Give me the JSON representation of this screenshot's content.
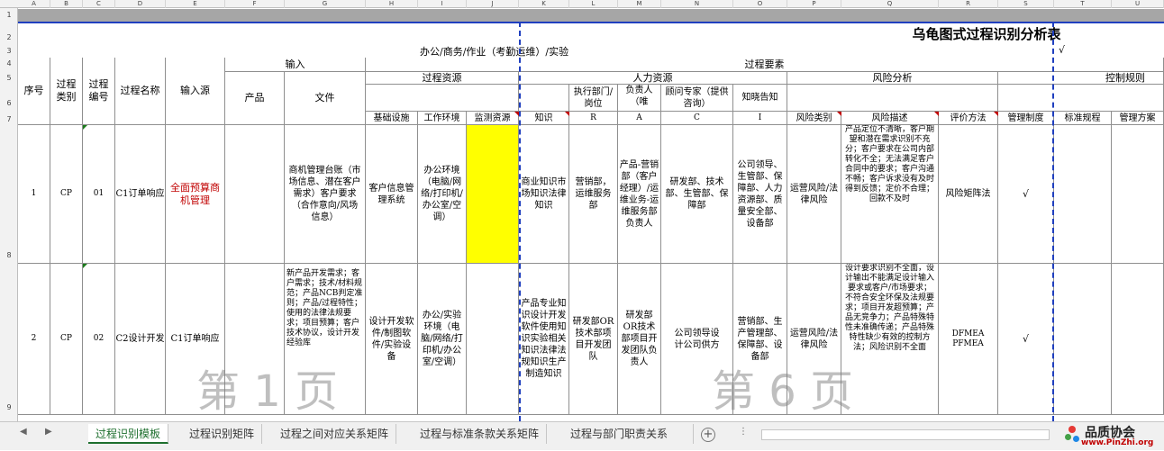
{
  "columns": [
    "A",
    "B",
    "C",
    "D",
    "E",
    "F",
    "G",
    "H",
    "I",
    "J",
    "K",
    "L",
    "M",
    "N",
    "O",
    "P",
    "Q",
    "R",
    "S",
    "T",
    "U"
  ],
  "rows": [
    "1",
    "2",
    "3",
    "4",
    "5",
    "6",
    "7",
    "8",
    "9"
  ],
  "title": "乌龟图式过程识别分析表",
  "subtitle": "办公/商务/作业（考勤运维）/实验",
  "check": "√",
  "headers": {
    "input": "输入",
    "process_elements": "过程要素",
    "seq": "序号",
    "ptype": "过程类别",
    "pnum": "过程编号",
    "pname": "过程名称",
    "input_src": "输入源",
    "product": "产品",
    "file": "文件",
    "process_resource": "过程资源",
    "hr": "人力资源",
    "risk": "风险分析",
    "control": "控制规则",
    "exec_dept": "执行部门/岗位",
    "owner": "负责人（唯",
    "consultant": "顾问专家（提供咨询）",
    "notify": "知晓告知",
    "infra": "基础设施",
    "workenv": "工作环境",
    "monitor": "监测资源",
    "knowledge": "知识",
    "r": "R",
    "a": "A",
    "cc": "C",
    "ii": "I",
    "risk_cat": "风险类别",
    "risk_desc": "风险描述",
    "eval": "评价方法",
    "mgmt_sys": "管理制度",
    "std_rule": "标准规程",
    "mgmt_plan": "管理方案"
  },
  "row1": {
    "seq": "1",
    "ptype": "CP",
    "pnum": "01",
    "pname": "C1订单响应",
    "input_src": "全面预算商机管理",
    "file": "商机管理台账（市场信息、潜在客户需求）客户要求（合作意向/风场信息）",
    "infra": "客户信息管理系统",
    "workenv": "办公环境（电脑/网络/打印机/办公室/空调）",
    "knowledge": "商业知识市场知识法律知识",
    "r": "营销部，运维服务部",
    "a": "产品-营销部（客户经理）/运维业务-运维服务部负责人",
    "cc": "研发部、技术部、生管部、保障部",
    "ii": "公司领导、生管部、保障部、人力资源部、质量安全部、设备部",
    "risk_cat": "运营风险/法律风险",
    "risk_desc": "产品定位不清晰，客户期望和潜在需求识别不充分；客户要求在公司内部转化不全；无法满足客户合同中的要求；客户沟通不畅；客户诉求没有及时得到反馈；定价不合理；回款不及时",
    "eval": "风险矩阵法"
  },
  "row2": {
    "seq": "2",
    "ptype": "CP",
    "pnum": "02",
    "pname": "C2设计开发",
    "input_src": "C1订单响应",
    "file": "新产品开发需求；客户需求；技术/材料规范；产品NCB判定准则；产品/过程特性；使用的法律法规要求；项目预算；客户技术协议，设计开发经验库",
    "infra": "设计开发软件/制图软件/实验设备",
    "workenv": "办公/实验环境（电脑/网络/打印机/办公室/空调）",
    "knowledge": "产品专业知识设计开发软件使用知识实验相关知识法律法规知识生产制造知识",
    "r": "研发部OR技术部项目开发团队",
    "a": "研发部OR技术部项目开发团队负责人",
    "cc": "公司领导设计公司供方",
    "ii": "营销部、生产管理部、保障部、设备部",
    "risk_cat": "运营风险/法律风险",
    "risk_desc": "设计要求识别不全面，设计输出不能满足设计输入要求或客户/市场要求；不符合安全环保及法规要求；项目开发超预算；产品无竞争力；产品特殊特性未准确传递；产品特殊特性缺少有效的控制方法；风险识别不全面",
    "eval": "DFMEA PFMEA"
  },
  "watermarks": [
    "第 1 页",
    "第 6 页"
  ],
  "tabs": [
    "过程识别模板",
    "过程识别矩阵",
    "过程之间对应关系矩阵",
    "过程与标准条款关系矩阵",
    "过程与部门职责关系"
  ],
  "active_tab": 0,
  "add_sheet": "+",
  "logo": {
    "name": "品质协会",
    "url": "www.PinZhi.org"
  }
}
